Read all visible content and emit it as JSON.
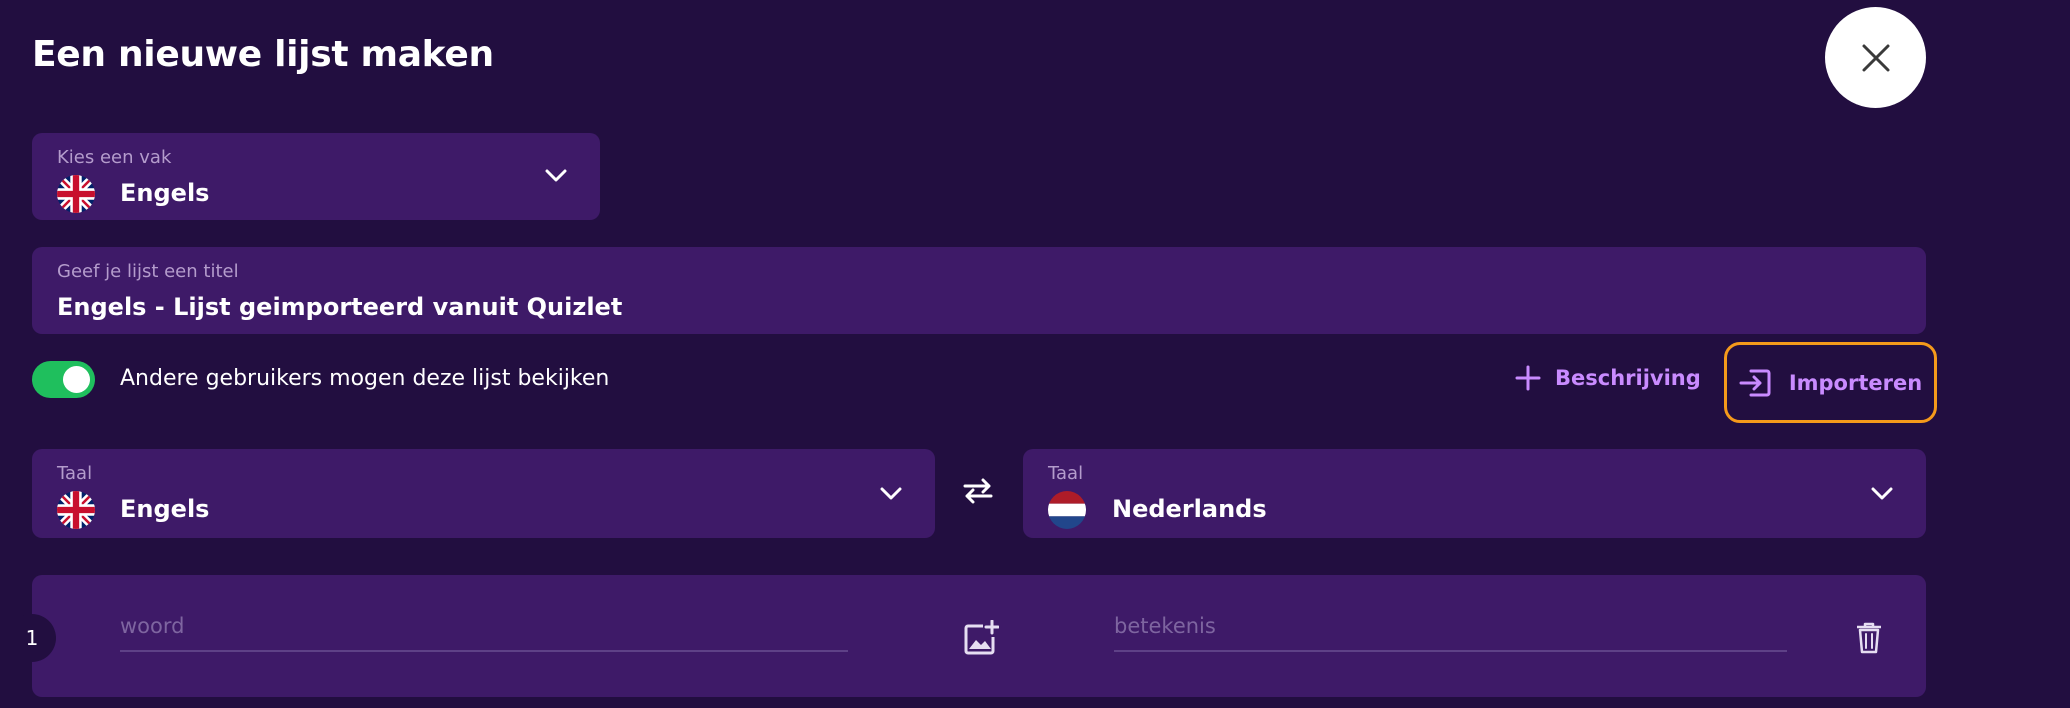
{
  "header": {
    "title": "Een nieuwe lijst maken"
  },
  "subject": {
    "label": "Kies een vak",
    "value": "Engels",
    "flag": "uk-flag-icon"
  },
  "list_title": {
    "label": "Geef je lijst een titel",
    "value": "Engels - Lijst geimporteerd vanuit Quizlet"
  },
  "visibility": {
    "enabled": true,
    "label": "Andere gebruikers mogen deze lijst bekijken"
  },
  "actions": {
    "description_label": "Beschrijving",
    "import_label": "Importeren"
  },
  "languages": {
    "left": {
      "label": "Taal",
      "value": "Engels",
      "flag": "uk-flag-icon"
    },
    "right": {
      "label": "Taal",
      "value": "Nederlands",
      "flag": "nl-flag-icon"
    }
  },
  "entries": [
    {
      "number": "1",
      "word_placeholder": "woord",
      "meaning_placeholder": "betekenis"
    }
  ],
  "colors": {
    "background": "#220e40",
    "field": "#3e1a68",
    "accent": "#c98bff",
    "toggle_on": "#1fbf5d",
    "highlight_border": "#f59a1b"
  }
}
